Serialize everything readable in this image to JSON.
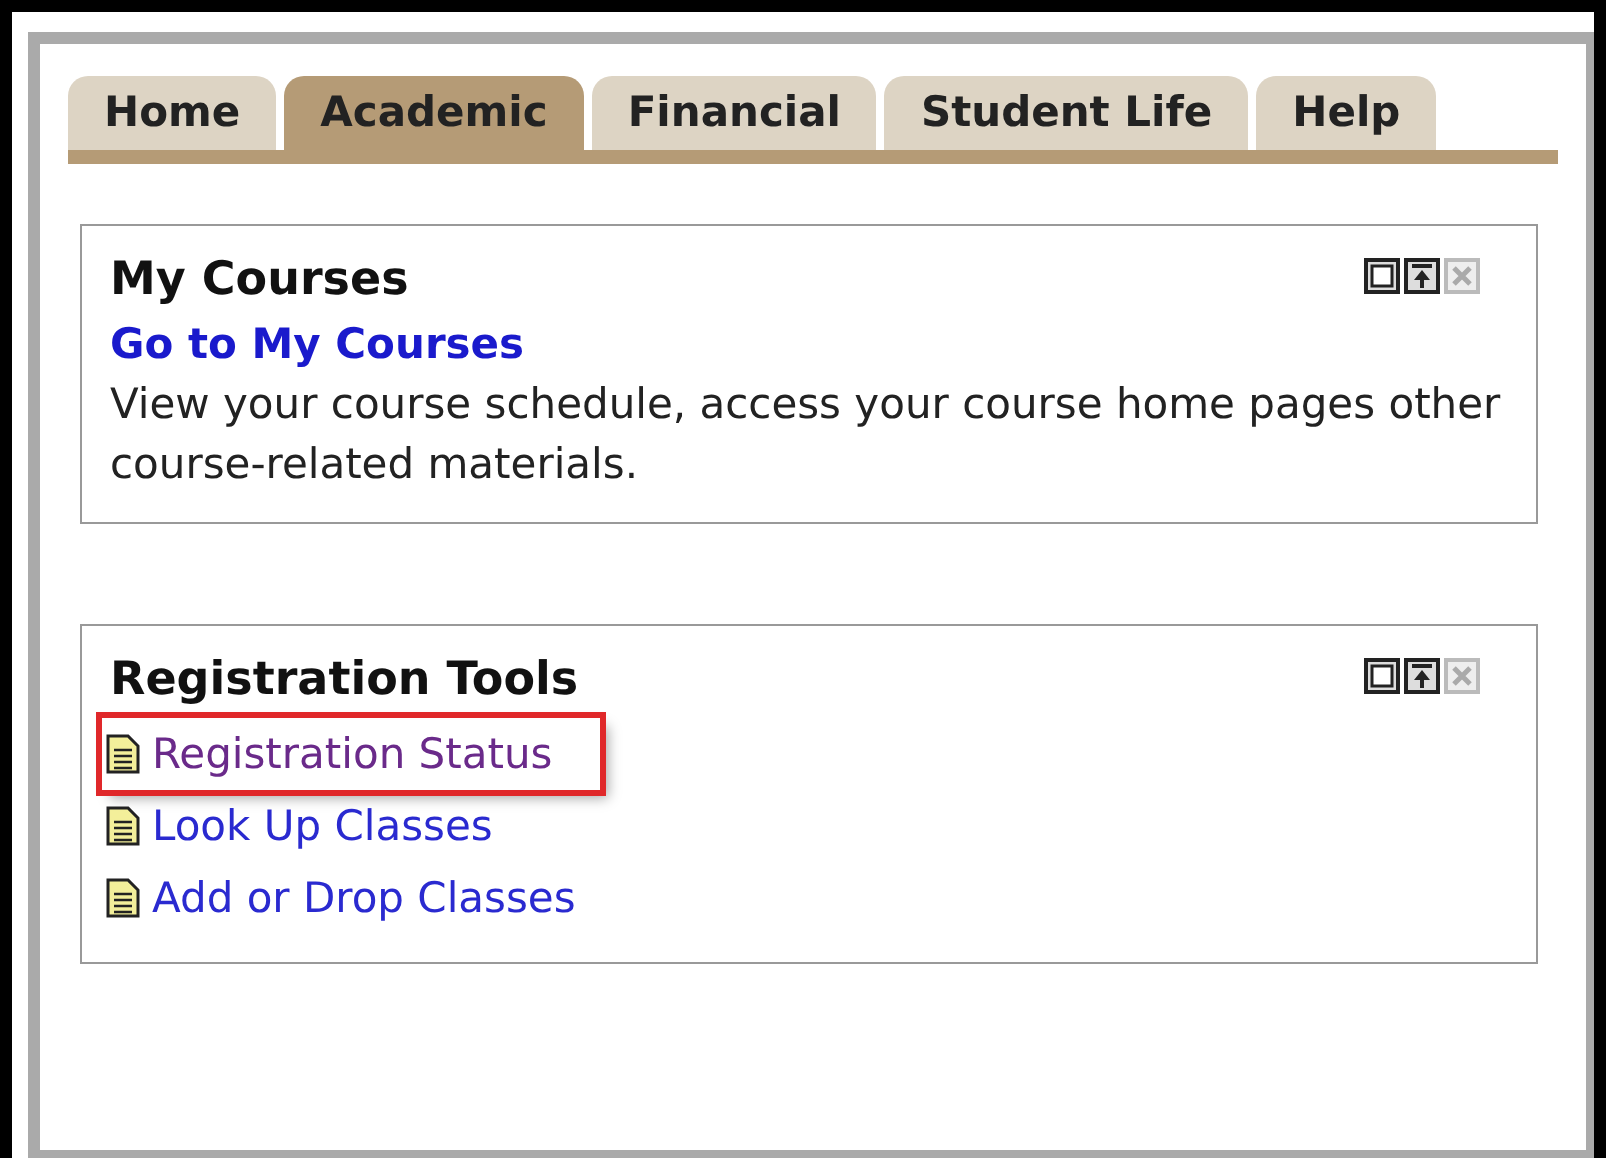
{
  "tabs": [
    {
      "label": "Home",
      "selected": false
    },
    {
      "label": "Academic",
      "selected": true
    },
    {
      "label": "Financial",
      "selected": false
    },
    {
      "label": "Student Life",
      "selected": false
    },
    {
      "label": "Help",
      "selected": false
    }
  ],
  "panels": [
    {
      "title": "My Courses",
      "kind": "text",
      "link": "Go to My Courses",
      "description": "View your course schedule, access your course home pages other course-related materials."
    },
    {
      "title": "Registration Tools",
      "kind": "links",
      "links": [
        {
          "label": "Registration Status",
          "visited": true,
          "highlighted": true
        },
        {
          "label": "Look Up Classes",
          "visited": false,
          "highlighted": false
        },
        {
          "label": "Add or Drop Classes",
          "visited": false,
          "highlighted": false
        }
      ]
    }
  ]
}
